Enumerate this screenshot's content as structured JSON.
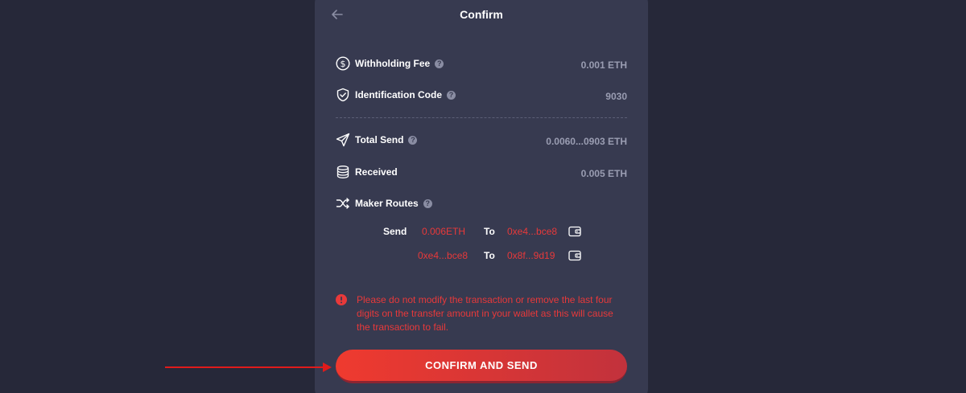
{
  "header": {
    "title": "Confirm"
  },
  "rows": {
    "withholding_fee": {
      "label": "Withholding Fee",
      "value": "0.001 ETH"
    },
    "identification_code": {
      "label": "Identification Code",
      "value": "9030"
    },
    "total_send": {
      "label": "Total Send",
      "value": "0.0060...0903 ETH"
    },
    "received": {
      "label": "Received",
      "value": "0.005 ETH"
    },
    "maker_routes": {
      "label": "Maker Routes"
    }
  },
  "routes": [
    {
      "label": "Send",
      "from": "0.006ETH",
      "to_label": "To",
      "to": "0xe4...bce8"
    },
    {
      "label": "",
      "from": "0xe4...bce8",
      "to_label": "To",
      "to": "0x8f...9d19"
    }
  ],
  "warning": {
    "text": "Please do not modify the transaction or remove the last four digits on the transfer amount in your wallet as this will cause the transaction to fail."
  },
  "confirm_button": {
    "label": "CONFIRM AND SEND"
  },
  "colors": {
    "background": "#262839",
    "panel": "#373a50",
    "accent_red": "#e8393a",
    "annotation_arrow": "#e01b1b"
  },
  "icons": {
    "back": "arrow-left-icon",
    "withholding_fee": "dollar-circle-icon",
    "identification_code": "shield-check-icon",
    "total_send": "paper-plane-icon",
    "received": "coin-stack-icon",
    "maker_routes": "shuffle-icon",
    "wallet": "wallet-icon",
    "warning": "exclamation-circle-icon",
    "help": "question-circle-icon"
  }
}
